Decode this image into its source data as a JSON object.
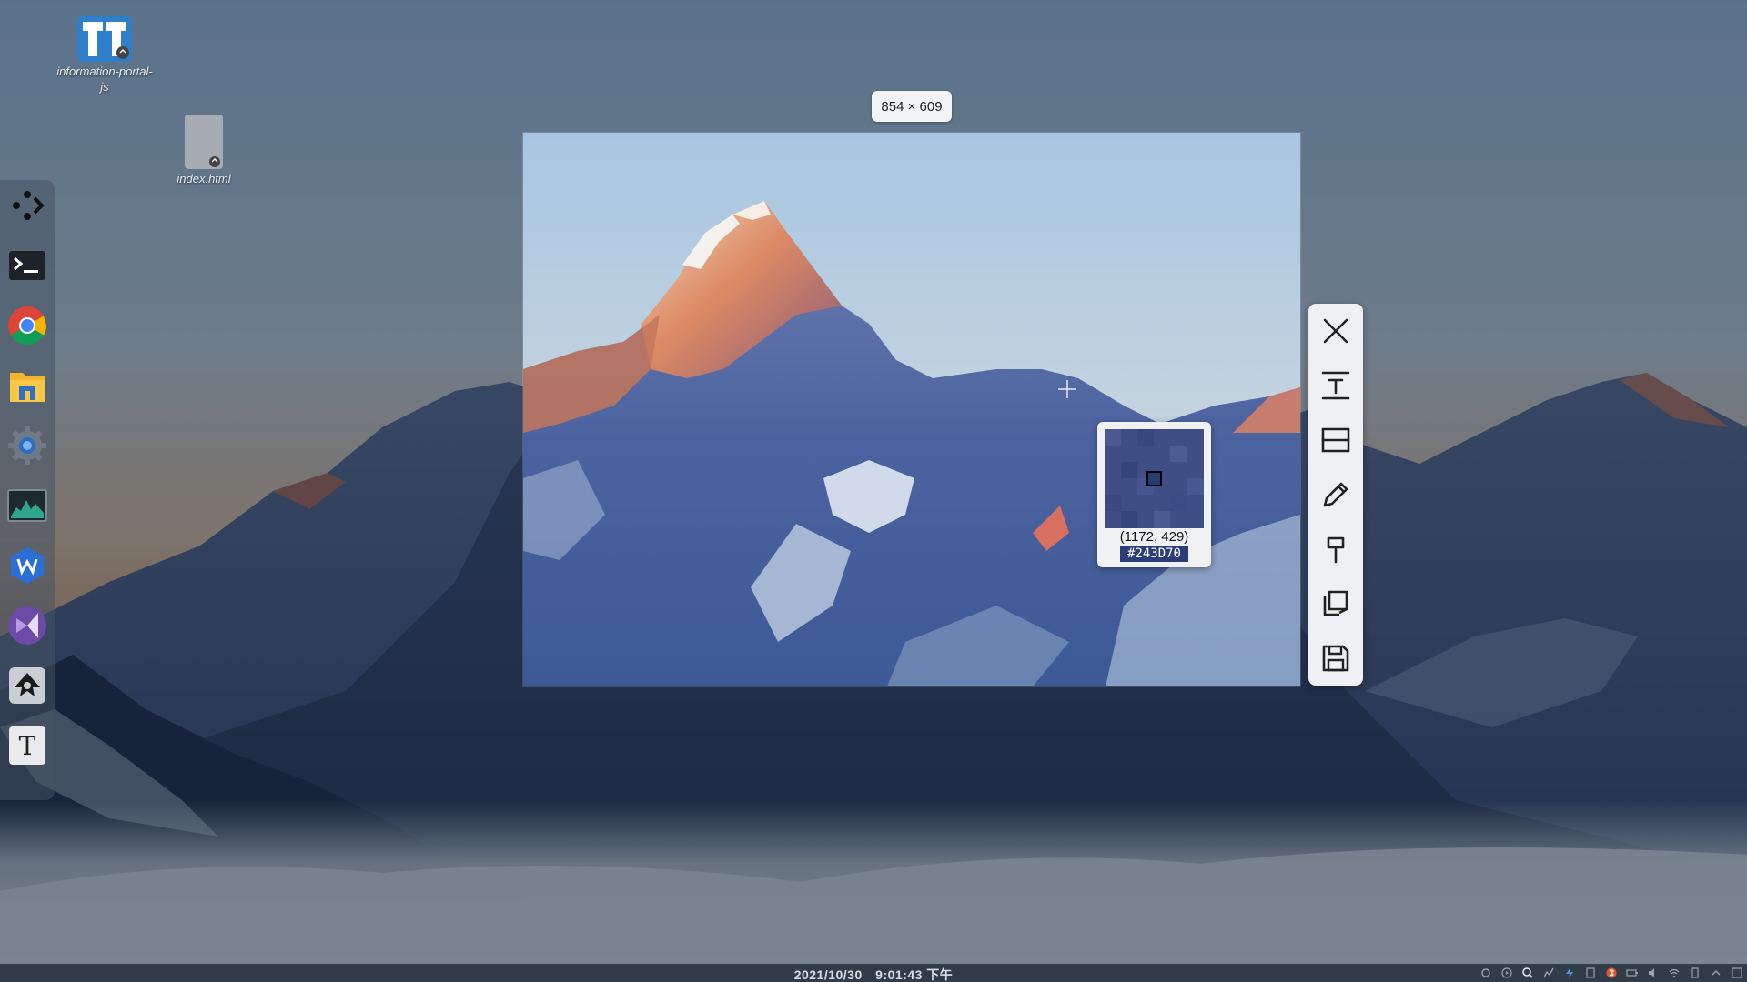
{
  "desktop": {
    "icons": [
      {
        "label": "information-portal-js",
        "icon": "project-folder-icon"
      },
      {
        "label": "index.html",
        "icon": "html-file-icon"
      }
    ]
  },
  "dock": {
    "items": [
      {
        "name": "launcher",
        "icon": "launcher-icon"
      },
      {
        "name": "terminal",
        "icon": "terminal-icon"
      },
      {
        "name": "chrome",
        "icon": "chrome-icon"
      },
      {
        "name": "file-manager",
        "icon": "file-manager-icon"
      },
      {
        "name": "settings",
        "icon": "settings-icon"
      },
      {
        "name": "system-monitor",
        "icon": "system-monitor-icon"
      },
      {
        "name": "wps-writer",
        "icon": "wps-writer-icon"
      },
      {
        "name": "visual-studio",
        "icon": "visual-studio-icon"
      },
      {
        "name": "inkscape",
        "icon": "inkscape-icon"
      },
      {
        "name": "text-editor",
        "icon": "text-editor-icon",
        "glyph": "T"
      }
    ]
  },
  "screenshot_tool": {
    "selection_size": "854 × 609",
    "toolbar": [
      {
        "name": "close",
        "icon": "close-icon"
      },
      {
        "name": "ocr-text",
        "icon": "text-recognition-icon"
      },
      {
        "name": "scroll-capture",
        "icon": "scroll-capture-icon"
      },
      {
        "name": "annotate",
        "icon": "pencil-icon"
      },
      {
        "name": "pin",
        "icon": "pin-icon"
      },
      {
        "name": "copy",
        "icon": "copy-icon"
      },
      {
        "name": "save",
        "icon": "save-icon"
      }
    ],
    "magnifier": {
      "coords": "(1172, 429)",
      "color_hex": "#243D70"
    }
  },
  "taskbar": {
    "date": "2021/10/30",
    "time": "9:01:43 下午",
    "tray_icons": [
      "network-icon",
      "media-icon",
      "search-icon",
      "chart-icon",
      "bolt-icon",
      "clipboard-icon",
      "sogou-input-icon",
      "battery-icon",
      "volume-icon",
      "wifi-icon",
      "usb-icon",
      "arrow-up-icon",
      "notification-icon"
    ]
  },
  "colors": {
    "toolbar_bg": "#eef0f3",
    "magnifier_pixel": "#243D70",
    "dim_overlay": "#142234"
  }
}
